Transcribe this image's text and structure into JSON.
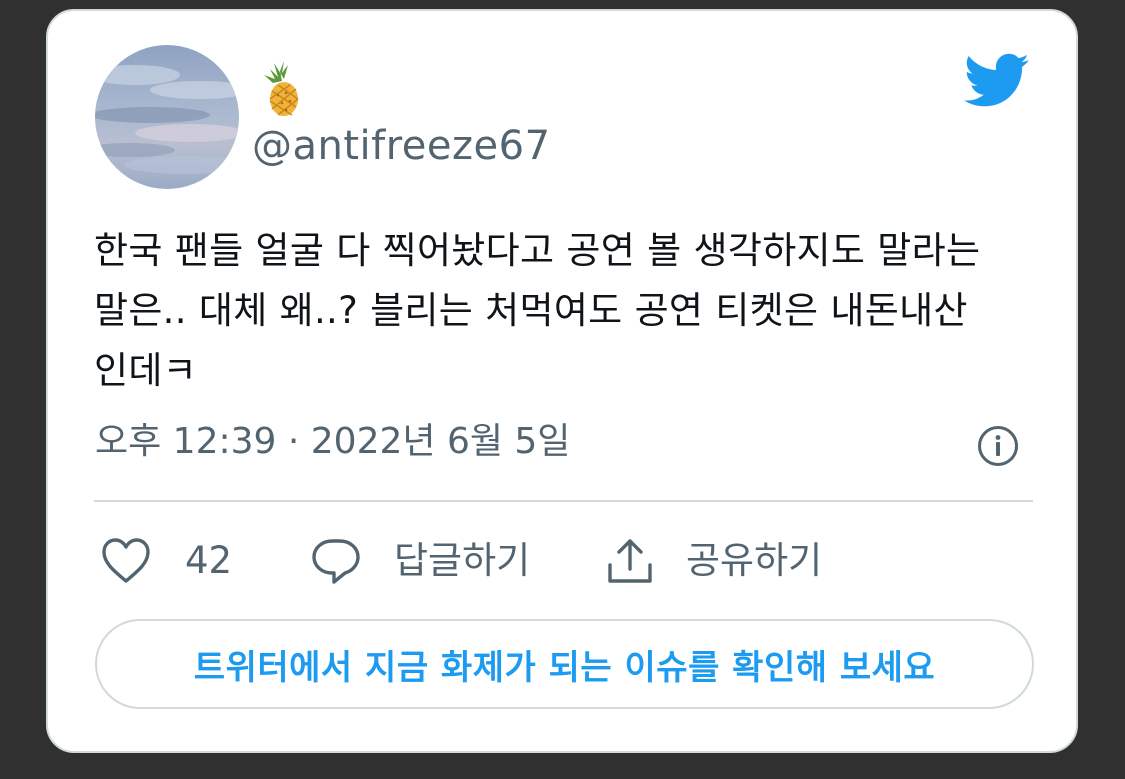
{
  "author": {
    "display_name": "🍍",
    "handle": "@antifreeze67",
    "avatar": "sky-clouds-avatar"
  },
  "tweet": {
    "text_lines": [
      "한국 팬들 얼굴 다 찍어놨다고 공연 볼 생각하지도 말라는",
      "말은.. 대체 왜..? 블리는 처먹여도 공연 티켓은 내돈내산",
      "인데ㅋ"
    ],
    "timestamp": "오후 12:39 · 2022년 6월 5일"
  },
  "actions": {
    "like_count": "42",
    "reply_label": "답글하기",
    "share_label": "공유하기"
  },
  "cta": {
    "label": "트위터에서 지금 화제가 되는 이슈를 확인해 보세요"
  },
  "icons": {
    "logo": "twitter-bird-icon",
    "info": "info-icon",
    "like": "heart-icon",
    "reply": "speech-bubble-icon",
    "share": "share-icon"
  },
  "colors": {
    "brand": "#1d9bf0",
    "text": "#0f1419",
    "secondary_text": "#536471",
    "border": "#cfd9de",
    "backdrop": "#303030"
  }
}
